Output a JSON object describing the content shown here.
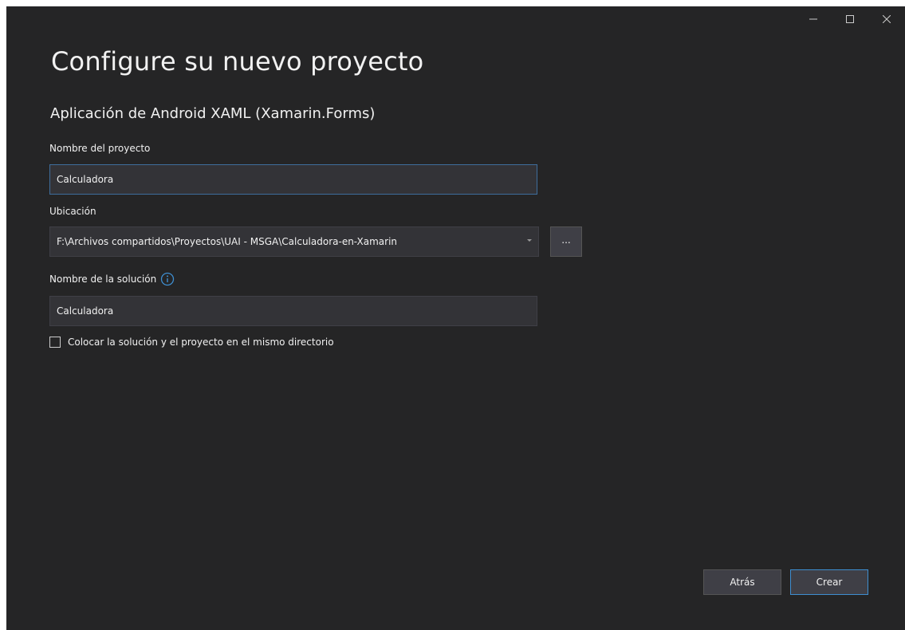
{
  "window": {
    "controls": {
      "minimize": "—",
      "maximize": "☐",
      "close": "✕"
    }
  },
  "page": {
    "title": "Configure su nuevo proyecto",
    "template_name": "Aplicación de Android XAML (Xamarin.Forms)"
  },
  "form": {
    "project_name": {
      "label": "Nombre del proyecto",
      "value": "Calculadora"
    },
    "location": {
      "label": "Ubicación",
      "value": "F:\\Archivos compartidos\\Proyectos\\UAI - MSGA\\Calculadora-en-Xamarin",
      "browse_label": "..."
    },
    "solution_name": {
      "label": "Nombre de la solución",
      "value": "Calculadora"
    },
    "same_directory": {
      "label": "Colocar la solución y el proyecto en el mismo directorio",
      "checked": false
    }
  },
  "footer": {
    "back_label": "Atrás",
    "create_label": "Crear"
  },
  "colors": {
    "background": "#252526",
    "field": "#333337",
    "accent": "#3e8ed0"
  }
}
